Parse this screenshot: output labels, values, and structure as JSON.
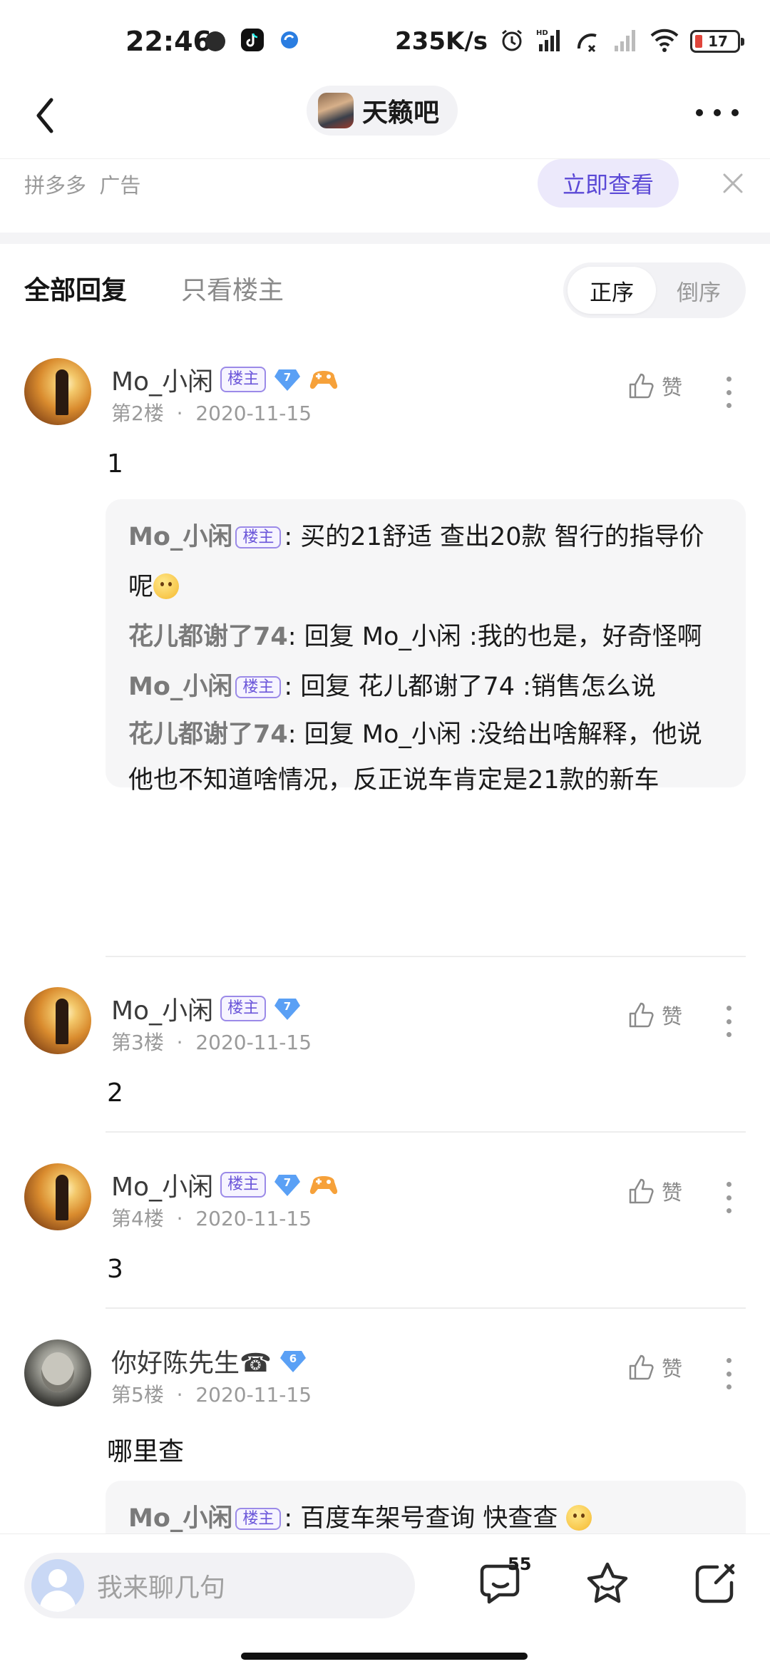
{
  "status_bar": {
    "time": "22:46",
    "net_speed": "235K/s",
    "battery": "17",
    "icons": [
      "alarm-icon",
      "signal-hd-icon",
      "signal-icon",
      "wifi-icon",
      "battery-icon"
    ],
    "app_icons": [
      "app-circle-icon",
      "tiktok-icon",
      "browser-icon"
    ]
  },
  "nav": {
    "forum_name": "天籁吧",
    "icons": [
      "back-icon",
      "more-icon"
    ]
  },
  "ad": {
    "source_label": "拼多多  广告",
    "cta": "立即查看"
  },
  "tabs": {
    "all": "全部回复",
    "op_only": "只看楼主",
    "order_asc": "正序",
    "order_desc": "倒序"
  },
  "labels": {
    "op_tag": "楼主",
    "like": "赞"
  },
  "posts": [
    {
      "username": "Mo_小闲",
      "level": "7",
      "meta": "第2楼  ·  2020-11-15",
      "content": "1",
      "replies": [
        {
          "who": "Mo_小闲",
          "op": true,
          "text": ": 买的21舒适 查出20款 智行的指导价呢"
        },
        {
          "who": "花儿都谢了74",
          "op": false,
          "text": ": 回复 Mo_小闲 :我的也是，好奇怪啊"
        },
        {
          "who": "Mo_小闲",
          "op": true,
          "text": ": 回复 花儿都谢了74 :销售怎么说"
        },
        {
          "who": "花儿都谢了74",
          "op": false,
          "text": ": 回复 Mo_小闲 :没给出啥解释，他说他也不知道啥情况，反正说车肯定是21款的新车"
        }
      ]
    },
    {
      "username": "Mo_小闲",
      "level": "7",
      "meta": "第3楼  ·  2020-11-15",
      "content": "2"
    },
    {
      "username": "Mo_小闲",
      "level": "7",
      "meta": "第4楼  ·  2020-11-15",
      "content": "3"
    },
    {
      "username": "你好陈先生☎",
      "level": "6",
      "meta": "第5楼  ·  2020-11-15",
      "content": "哪里查",
      "replies": [
        {
          "who": "Mo_小闲",
          "op": true,
          "text": ": 百度车架号查询 快查查"
        }
      ]
    }
  ],
  "bottom": {
    "placeholder": "我来聊几句",
    "comment_count": "55"
  },
  "colors": {
    "accent": "#5b49d6",
    "op_tag": "#6a55d9",
    "level_badge": "#5aa0f5",
    "muted": "#9a9a9a"
  }
}
